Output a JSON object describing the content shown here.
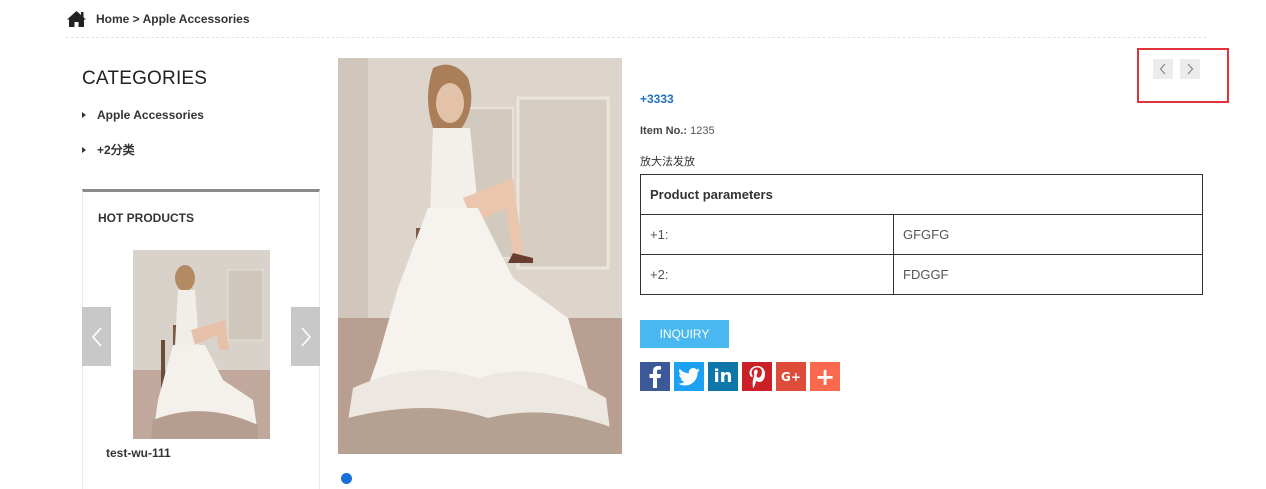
{
  "breadcrumb": {
    "home": "Home",
    "separator": " > ",
    "current": "Apple Accessories"
  },
  "sidebar": {
    "title": "CATEGORIES",
    "categories": [
      {
        "label": "Apple Accessories"
      },
      {
        "label": "+2分类"
      }
    ],
    "hot_products": {
      "title": "HOT PRODUCTS",
      "items": [
        {
          "name": "test-wu-111"
        }
      ]
    }
  },
  "product": {
    "title": "+3333",
    "item_no_label": "Item No.:",
    "item_no": "1235",
    "description": "放大法发放",
    "params_header": "Product parameters",
    "params": [
      {
        "key": "+1:",
        "value": "GFGFG"
      },
      {
        "key": "+2:",
        "value": "FDGGF"
      }
    ],
    "inquiry_label": "INQUIRY"
  },
  "share": [
    {
      "icon": "facebook-icon",
      "glyph": "f",
      "color": "#3b5998"
    },
    {
      "icon": "twitter-icon",
      "glyph": "bird",
      "color": "#1da1f2"
    },
    {
      "icon": "linkedin-icon",
      "glyph": "in",
      "color": "#0e76a8"
    },
    {
      "icon": "pinterest-icon",
      "glyph": "P",
      "color": "#cb2027"
    },
    {
      "icon": "google-plus-icon",
      "glyph": "G+",
      "color": "#dd4b39"
    },
    {
      "icon": "addthis-icon",
      "glyph": "+",
      "color": "#f8694d"
    }
  ],
  "colors": {
    "link": "#1e73be",
    "inquiry": "#4ab8f0",
    "dot": "#1a6fd6",
    "highlight": "#e0343a"
  }
}
